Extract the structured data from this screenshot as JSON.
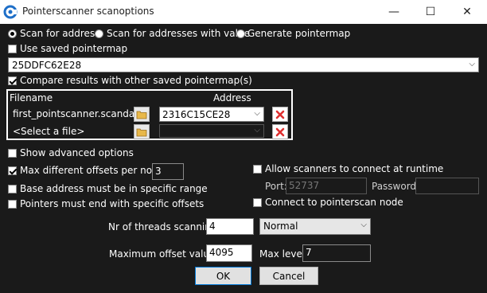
{
  "window": {
    "title": "Pointerscanner scanoptions",
    "min_glyph": "—",
    "max_glyph": "☐",
    "close_glyph": "✕"
  },
  "scan_mode": {
    "options": [
      "Scan for address",
      "Scan for addresses with value",
      "Generate pointermap"
    ],
    "selected": 0
  },
  "saved_pointermap": {
    "label": "Use saved pointermap",
    "checked": false,
    "value": "25DDFC62E28"
  },
  "compare": {
    "label": "Compare results with other saved pointermap(s)",
    "checked": true,
    "headers": {
      "filename": "Filename",
      "address": "Address"
    },
    "rows": [
      {
        "filename": "first_pointscanner.scandata",
        "address": "2316C15CE28"
      },
      {
        "filename": "<Select a file>",
        "address": ""
      }
    ]
  },
  "advanced": {
    "label": "Show advanced options",
    "checked": false
  },
  "max_offsets": {
    "label": "Max different offsets per node:",
    "checked": true,
    "value": "3"
  },
  "base_range": {
    "label": "Base address must be in specific range",
    "checked": false
  },
  "pointers_end": {
    "label": "Pointers must end with specific offsets",
    "checked": false
  },
  "allow_scanners": {
    "label": "Allow scanners to connect at runtime",
    "checked": false
  },
  "port": {
    "label": "Port:",
    "value": "52737"
  },
  "password": {
    "label": "Password",
    "value": ""
  },
  "connect_node": {
    "label": "Connect to pointerscan node",
    "checked": false
  },
  "threads": {
    "label": "Nr of threads scanning:",
    "value": "4",
    "priority": "Normal"
  },
  "max_offset_value": {
    "label": "Maximum offset value:",
    "value": "4095"
  },
  "max_level": {
    "label": "Max level",
    "value": "7"
  },
  "buttons": {
    "ok": "OK",
    "cancel": "Cancel"
  },
  "colors": {
    "background": "#1a1a1a",
    "titlebar": "#ffffff",
    "delete_red": "#e03030",
    "folder_yellow": "#e8b84a"
  }
}
